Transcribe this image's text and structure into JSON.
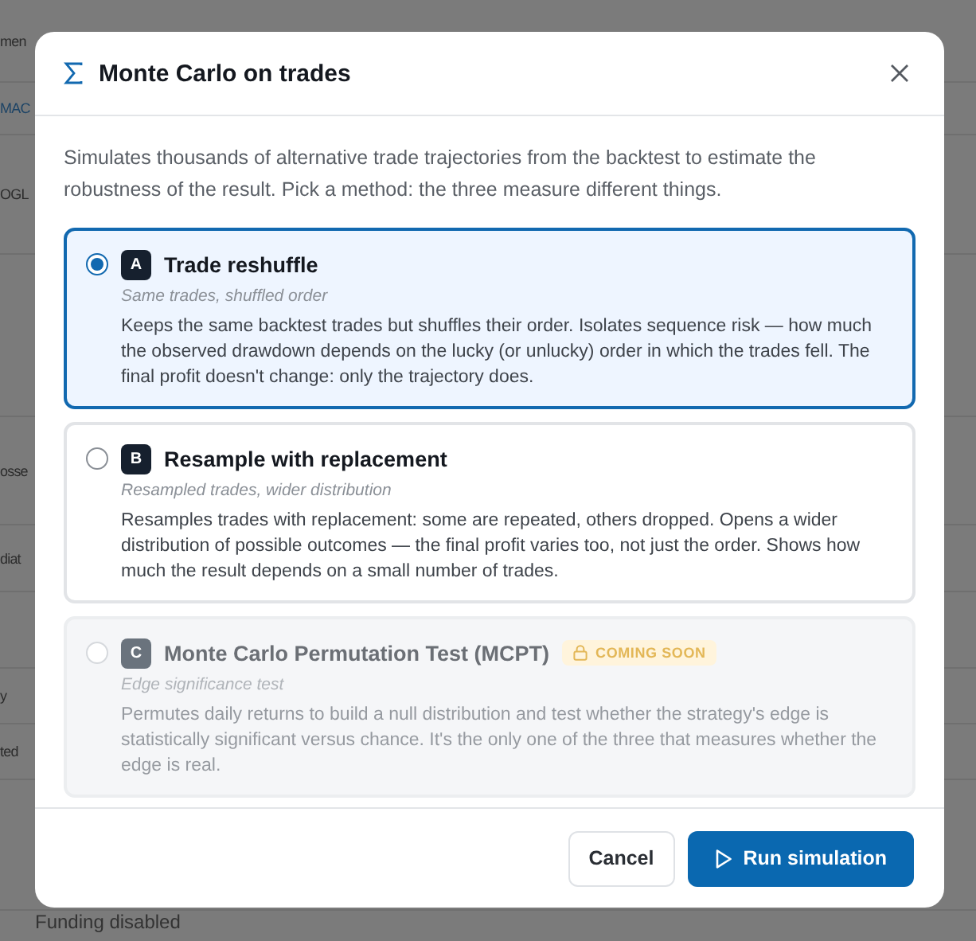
{
  "background": {
    "rows": [
      {
        "text": "men",
        "kind": "plain"
      },
      {
        "text": "MAC",
        "kind": "link"
      },
      {
        "text": "OGL",
        "kind": "plain"
      },
      {
        "text": "osse",
        "kind": "plain"
      },
      {
        "text": "diat",
        "kind": "plain"
      },
      {
        "text": "y",
        "kind": "plain"
      },
      {
        "text": "ted",
        "kind": "plain"
      }
    ],
    "footer_text": "Funding disabled"
  },
  "dialog": {
    "title": "Monte Carlo on trades",
    "description": "Simulates thousands of alternative trade trajectories from the backtest to estimate the robustness of the result. Pick a method: the three measure different things.",
    "options": [
      {
        "letter": "A",
        "title": "Trade reshuffle",
        "subtitle": "Same trades, shuffled order",
        "description": "Keeps the same backtest trades but shuffles their order. Isolates sequence risk — how much the observed drawdown depends on the lucky (or unlucky) order in which the trades fell. The final profit doesn't change: only the trajectory does.",
        "selected": true,
        "disabled": false
      },
      {
        "letter": "B",
        "title": "Resample with replacement",
        "subtitle": "Resampled trades, wider distribution",
        "description": "Resamples trades with replacement: some are repeated, others dropped. Opens a wider distribution of possible outcomes — the final profit varies too, not just the order. Shows how much the result depends on a small number of trades.",
        "selected": false,
        "disabled": false
      },
      {
        "letter": "C",
        "title": "Monte Carlo Permutation Test (MCPT)",
        "badge": "COMING SOON",
        "subtitle": "Edge significance test",
        "description": "Permutes daily returns to build a null distribution and test whether the strategy's edge is statistically significant versus chance. It's the only one of the three that measures whether the edge is real.",
        "selected": false,
        "disabled": true
      }
    ],
    "buttons": [
      {
        "label": "Cancel",
        "kind": "secondary"
      },
      {
        "label": "Run simulation",
        "kind": "primary"
      }
    ]
  }
}
